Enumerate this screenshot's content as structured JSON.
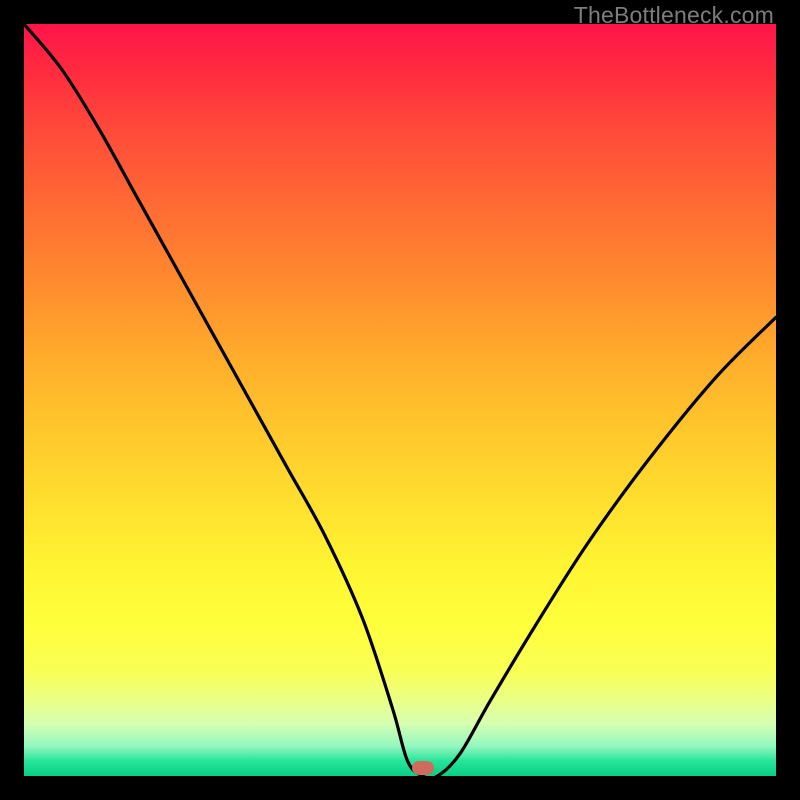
{
  "watermark": "TheBottleneck.com",
  "colors": {
    "frame": "#000000",
    "curve": "#000000",
    "marker": "#cf6a5e"
  },
  "chart_data": {
    "type": "line",
    "title": "",
    "xlabel": "",
    "ylabel": "",
    "xlim": [
      0,
      100
    ],
    "ylim": [
      0,
      100
    ],
    "grid": false,
    "legend": false,
    "marker": {
      "x": 53,
      "y": 1
    },
    "series": [
      {
        "name": "bottleneck-curve",
        "x": [
          0,
          5,
          10,
          15,
          20,
          25,
          30,
          35,
          40,
          45,
          49,
          51,
          53,
          55,
          58,
          62,
          68,
          75,
          83,
          92,
          100
        ],
        "values": [
          100,
          94,
          86,
          77,
          68,
          59,
          50,
          41,
          32,
          21,
          9,
          2,
          0,
          0,
          3,
          10,
          20,
          31,
          42,
          53,
          61
        ]
      }
    ],
    "background_gradient": {
      "0": "#ff144a",
      "50": "#ffc72c",
      "80": "#ffff3c",
      "100": "#07cf85"
    }
  }
}
